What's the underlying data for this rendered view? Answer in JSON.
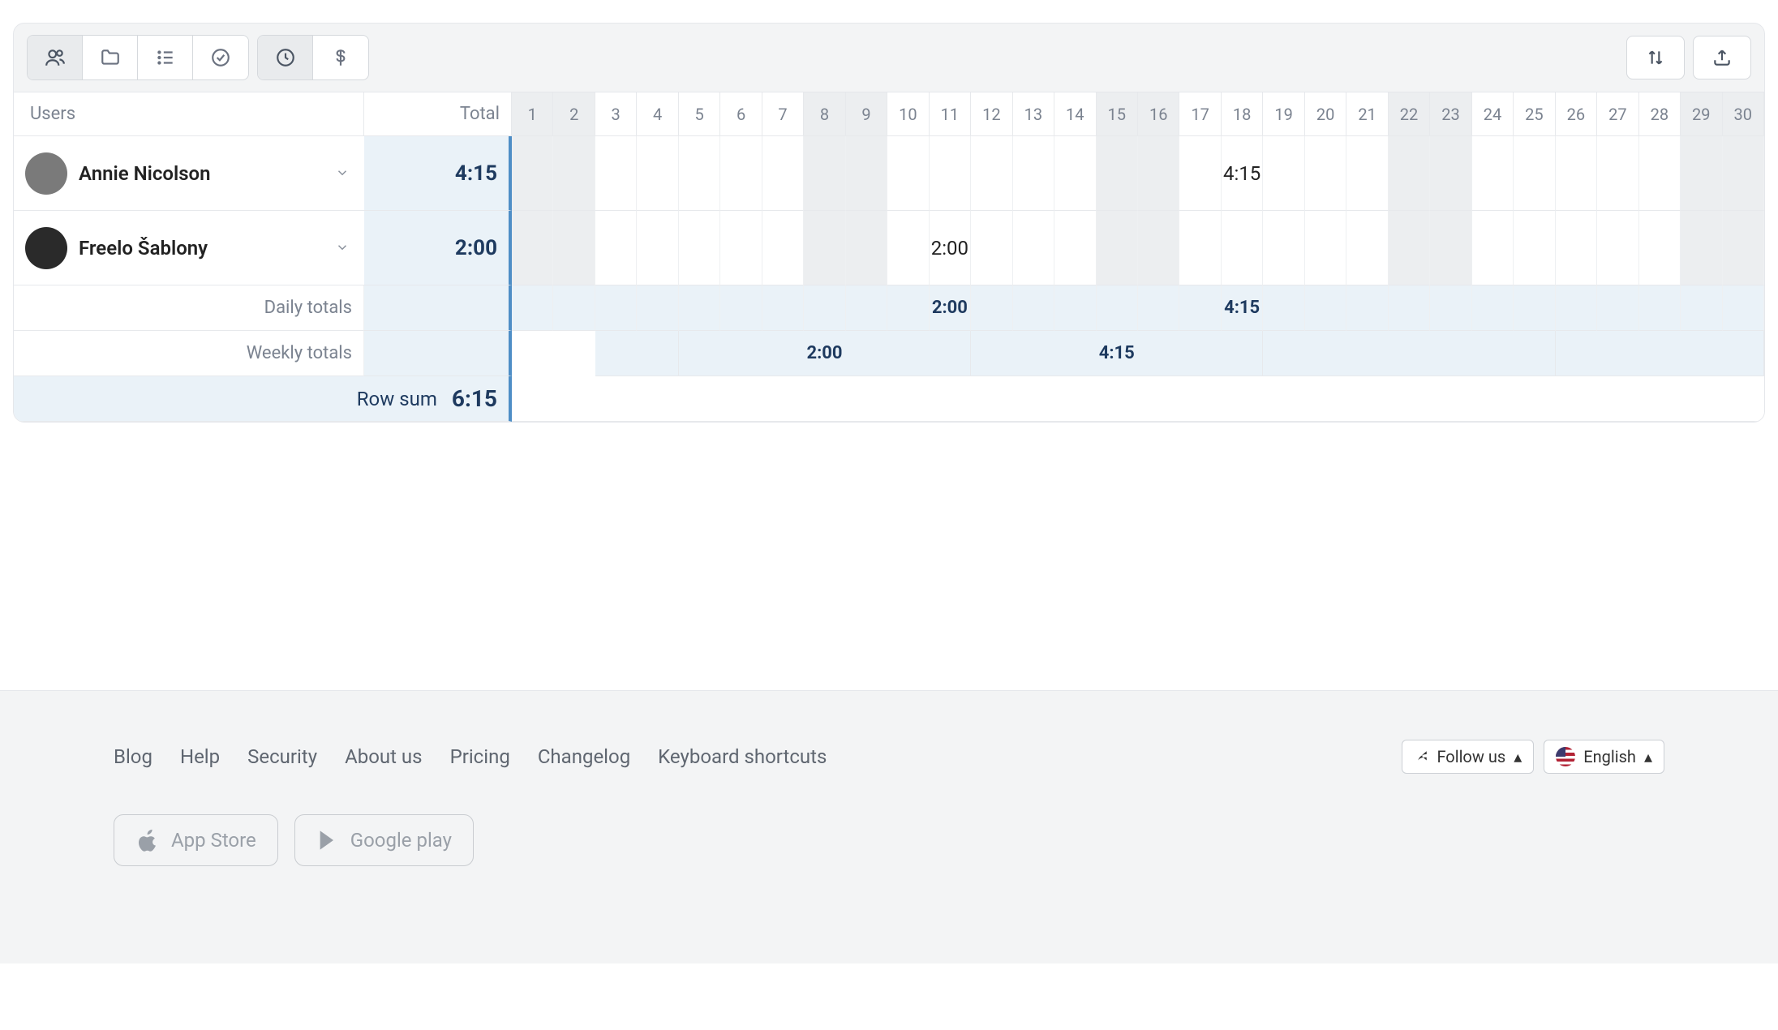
{
  "header": {
    "users_label": "Users",
    "total_label": "Total",
    "days": [
      "1",
      "2",
      "3",
      "4",
      "5",
      "6",
      "7",
      "8",
      "9",
      "10",
      "11",
      "12",
      "13",
      "14",
      "15",
      "16",
      "17",
      "18",
      "19",
      "20",
      "21",
      "22",
      "23",
      "24",
      "25",
      "26",
      "27",
      "28",
      "29",
      "30"
    ],
    "weekend_days": [
      1,
      2,
      8,
      9,
      15,
      16,
      22,
      23,
      29,
      30
    ]
  },
  "rows": [
    {
      "name": "Annie Nicolson",
      "total": "4:15",
      "cells": {
        "18": "4:15"
      }
    },
    {
      "name": "Freelo Šablony",
      "total": "2:00",
      "cells": {
        "11": "2:00"
      }
    }
  ],
  "totals": {
    "daily_label": "Daily totals",
    "daily": {
      "11": "2:00",
      "18": "4:15"
    },
    "weekly_label": "Weekly totals",
    "weekly_spans": [
      {
        "start": 3,
        "end": 4,
        "value": ""
      },
      {
        "start": 5,
        "end": 11,
        "value": "2:00"
      },
      {
        "start": 12,
        "end": 18,
        "value": "4:15"
      },
      {
        "start": 19,
        "end": 25,
        "value": ""
      },
      {
        "start": 26,
        "end": 30,
        "value": ""
      }
    ],
    "row_sum_label": "Row sum",
    "row_sum_value": "6:15"
  },
  "footer": {
    "links": [
      "Blog",
      "Help",
      "Security",
      "About us",
      "Pricing",
      "Changelog",
      "Keyboard shortcuts"
    ],
    "follow": "Follow us",
    "language": "English",
    "app_store": "App Store",
    "google_play": "Google play"
  }
}
